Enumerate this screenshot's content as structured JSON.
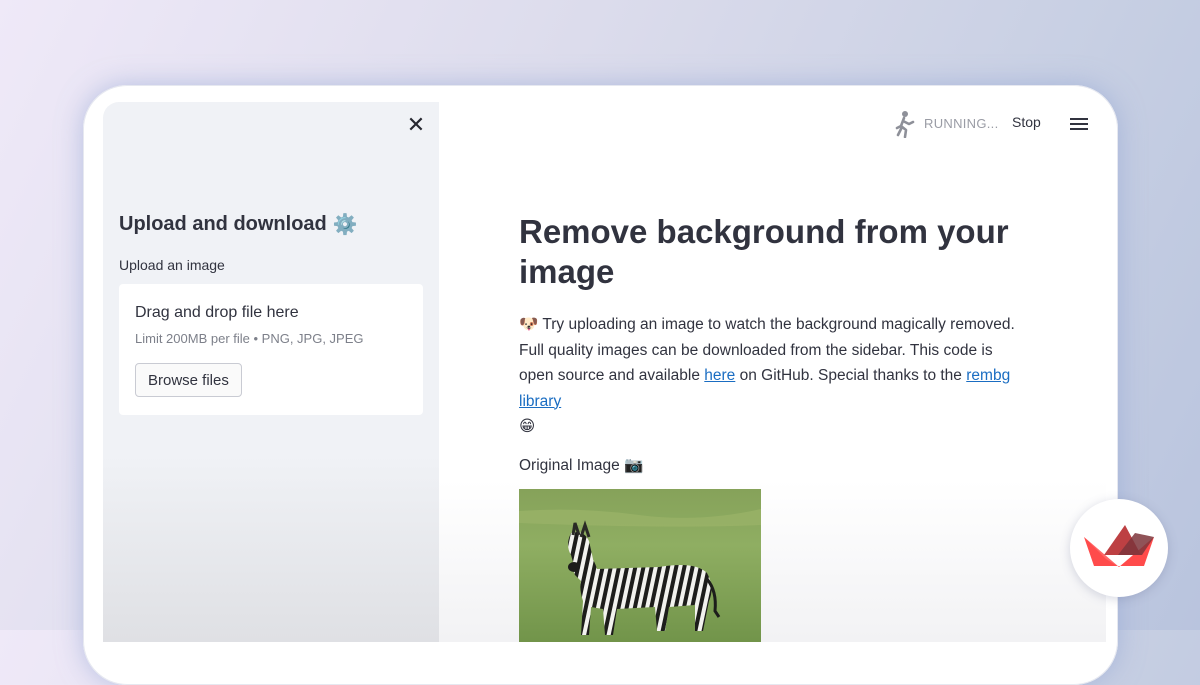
{
  "sidebar": {
    "close_icon": "close-icon",
    "title": "Upload and download",
    "title_icon": "gear-icon",
    "upload_label": "Upload an image",
    "dropzone": {
      "title": "Drag and drop file here",
      "limit": "Limit 200MB per file • PNG, JPG, JPEG",
      "browse_label": "Browse files"
    }
  },
  "topbar": {
    "status_icon": "running-person-icon",
    "status": "RUNNING...",
    "stop_label": "Stop",
    "menu_icon": "hamburger-menu-icon"
  },
  "main": {
    "title": "Remove background from your image",
    "intro_emoji": "🐶",
    "intro_text_1": "Try uploading an image to watch the background magically removed. Full quality images can be downloaded from the sidebar. This code is open source and available",
    "link_here": "here",
    "intro_text_2": "on GitHub. Special thanks to the",
    "link_rembg": "rembg library",
    "intro_end_emoji": "😁",
    "original_label": "Original Image",
    "original_emoji": "📷",
    "image_subject": "zebra-on-grass-photo"
  },
  "badge": {
    "icon": "streamlit-logo-icon"
  },
  "colors": {
    "link": "#1a6dc2",
    "text": "#31333f",
    "sidebar_bg": "#f0f2f6",
    "logo_red": "#ff4b4b"
  }
}
